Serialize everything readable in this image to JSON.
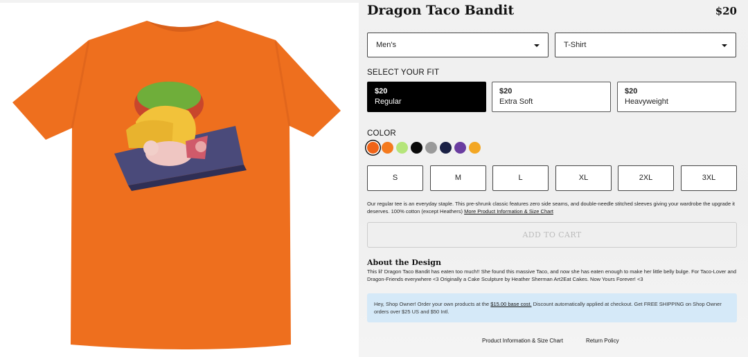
{
  "product": {
    "title": "Dragon Taco Bandit",
    "price": "$20"
  },
  "selects": {
    "gender": "Men's",
    "type": "T-Shirt"
  },
  "fit": {
    "label": "SELECT YOUR FIT",
    "options": [
      {
        "price": "$20",
        "name": "Regular",
        "selected": true
      },
      {
        "price": "$20",
        "name": "Extra Soft",
        "selected": false
      },
      {
        "price": "$20",
        "name": "Heavyweight",
        "selected": false
      }
    ]
  },
  "color": {
    "label": "COLOR",
    "swatches": [
      {
        "name": "orange",
        "hex": "#f06418",
        "selected": true
      },
      {
        "name": "bright orange",
        "hex": "#f47a1e",
        "selected": false
      },
      {
        "name": "lime",
        "hex": "#b5e57a",
        "selected": false
      },
      {
        "name": "black",
        "hex": "#0a0a0a",
        "selected": false
      },
      {
        "name": "grey",
        "hex": "#9a9a9a",
        "selected": false
      },
      {
        "name": "navy",
        "hex": "#1a2145",
        "selected": false
      },
      {
        "name": "purple",
        "hex": "#6a3da0",
        "selected": false
      },
      {
        "name": "gold",
        "hex": "#f3a724",
        "selected": false
      }
    ]
  },
  "sizes": [
    "S",
    "M",
    "L",
    "XL",
    "2XL",
    "3XL"
  ],
  "description": {
    "text": "Our regular tee is an everyday staple. This pre-shrunk classic features zero side seams, and double-needle stitched sleeves giving your wardrobe the upgrade it deserves. 100% cotton (except Heathers)",
    "link": "More Product Information & Size Chart"
  },
  "cart": {
    "label": "ADD TO CART"
  },
  "about": {
    "title": "About the Design",
    "body": "This lil' Dragon Taco Bandit has eaten too much!! She found this massive Taco, and now she has eaten enough to make her little belly bulge. For Taco-Lover and Dragon-Friends everywhere <3 Originally a Cake Sculpture by Heather Sherman Art2Eat Cakes. Now Yours Forever! <3"
  },
  "owner": {
    "pre": "Hey, Shop Owner! Order your own products at the",
    "link": "$15.00 base cost.",
    "post": "Discount automatically applied at checkout. Get FREE SHIPPING on Shop Owner orders over $25 US and $50 Intl."
  },
  "footer": {
    "links": [
      "Product Information & Size Chart",
      "Return Policy"
    ]
  },
  "colors": {
    "shirt": "#ee6f1e",
    "shirt_shadow": "#d9601a",
    "owner_banner": "#d5e9f8"
  }
}
